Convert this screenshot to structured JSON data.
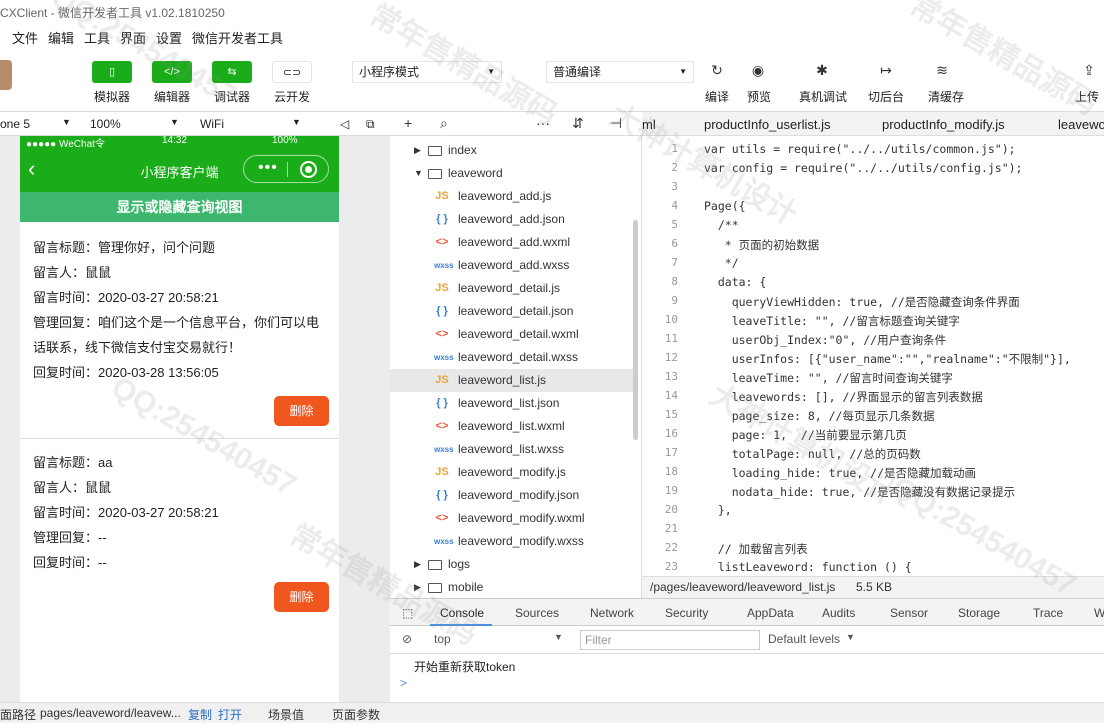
{
  "window": {
    "title": "CXClient - 微信开发者工具 v1.02.1810250"
  },
  "menu": [
    "文件",
    "编辑",
    "工具",
    "界面",
    "设置",
    "微信开发者工具"
  ],
  "toolbar": {
    "simulator": "模拟器",
    "editor": "编辑器",
    "debugger": "调试器",
    "cloud": "云开发",
    "mode_select": "小程序模式",
    "compile_select": "普通编译",
    "compile": "编译",
    "preview": "预览",
    "remote_debug": "真机调试",
    "background": "切后台",
    "clear_cache": "清缓存",
    "upload": "上传"
  },
  "simbar": {
    "device": "one 5",
    "zoom": "100%",
    "network": "WiFi"
  },
  "phone": {
    "status_carrier": "●●●●● WeChat令",
    "status_time": "14:32",
    "status_battery": "100%",
    "nav_title": "小程序客户端",
    "toggle_label": "显示或隐藏查询视图",
    "messages": [
      {
        "title": "留言标题：管理你好，问个问题",
        "person": "留言人：鼠鼠",
        "time": "留言时间：2020-03-27 20:58:21",
        "reply1": "管理回复：咱们这个是一个信息平台，你们可以电",
        "reply2": "话联系，线下微信支付宝交易就行！",
        "reply_time": "回复时间：2020-03-28 13:56:05",
        "delete": "删除"
      },
      {
        "title": "留言标题：aa",
        "person": "留言人：鼠鼠",
        "time": "留言时间：2020-03-27 20:58:21",
        "reply1": "管理回复：--",
        "reply_time": "回复时间：--",
        "delete": "删除"
      }
    ]
  },
  "tree": {
    "rows": [
      {
        "type": "folder",
        "name": "index",
        "open": false
      },
      {
        "type": "folder",
        "name": "leaveword",
        "open": true
      },
      {
        "type": "js",
        "name": "leaveword_add.js"
      },
      {
        "type": "json",
        "name": "leaveword_add.json"
      },
      {
        "type": "wxml",
        "name": "leaveword_add.wxml"
      },
      {
        "type": "wxss",
        "name": "leaveword_add.wxss"
      },
      {
        "type": "js",
        "name": "leaveword_detail.js"
      },
      {
        "type": "json",
        "name": "leaveword_detail.json"
      },
      {
        "type": "wxml",
        "name": "leaveword_detail.wxml"
      },
      {
        "type": "wxss",
        "name": "leaveword_detail.wxss"
      },
      {
        "type": "js",
        "name": "leaveword_list.js",
        "active": true
      },
      {
        "type": "json",
        "name": "leaveword_list.json"
      },
      {
        "type": "wxml",
        "name": "leaveword_list.wxml"
      },
      {
        "type": "wxss",
        "name": "leaveword_list.wxss"
      },
      {
        "type": "js",
        "name": "leaveword_modify.js"
      },
      {
        "type": "json",
        "name": "leaveword_modify.json"
      },
      {
        "type": "wxml",
        "name": "leaveword_modify.wxml"
      },
      {
        "type": "wxss",
        "name": "leaveword_modify.wxss"
      },
      {
        "type": "folder",
        "name": "logs",
        "open": false
      },
      {
        "type": "folder",
        "name": "mobile",
        "open": false
      }
    ]
  },
  "tabs": [
    "ml",
    "productInfo_userlist.js",
    "productInfo_modify.js",
    "leavewo"
  ],
  "code": [
    "var utils = require(\"../../utils/common.js\");",
    "var config = require(\"../../utils/config.js\");",
    "",
    "Page({",
    "  /**",
    "   * 页面的初始数据",
    "   */",
    "  data: {",
    "    queryViewHidden: true, //是否隐藏查询条件界面",
    "    leaveTitle: \"\", //留言标题查询关键字",
    "    userObj_Index:\"0\", //用户查询条件",
    "    userInfos: [{\"user_name\":\"\",\"realname\":\"不限制\"}],",
    "    leaveTime: \"\", //留言时间查询关键字",
    "    leavewords: [], //界面显示的留言列表数据",
    "    page_size: 8, //每页显示几条数据",
    "    page: 1,  //当前要显示第几页",
    "    totalPage: null, //总的页码数",
    "    loading_hide: true, //是否隐藏加载动画",
    "    nodata_hide: true, //是否隐藏没有数据记录提示",
    "  },",
    "",
    "  // 加载留言列表",
    "  listLeaveword: function () {"
  ],
  "file_status": {
    "path": "/pages/leaveword/leaveword_list.js",
    "size": "5.5 KB"
  },
  "console": {
    "tabs": [
      "Console",
      "Sources",
      "Network",
      "Security",
      "AppData",
      "Audits",
      "Sensor",
      "Storage",
      "Trace",
      "Wxml"
    ],
    "context": "top",
    "filter_placeholder": "Filter",
    "levels": "Default levels",
    "message": "开始重新获取token",
    "prompt": ">"
  },
  "statusbar": {
    "label": "面路径",
    "path": "pages/leaveword/leavew...",
    "copy": "复制",
    "open": "打开",
    "scene": "场景值",
    "params": "页面参数"
  },
  "watermarks": [
    "QQ:254540457",
    "常年售精品源码",
    "大神计算机设计",
    "QQ:254540457",
    "常年售精品源码",
    "大神计算机设计",
    "QQ:254540457",
    "常年售精品源码"
  ]
}
